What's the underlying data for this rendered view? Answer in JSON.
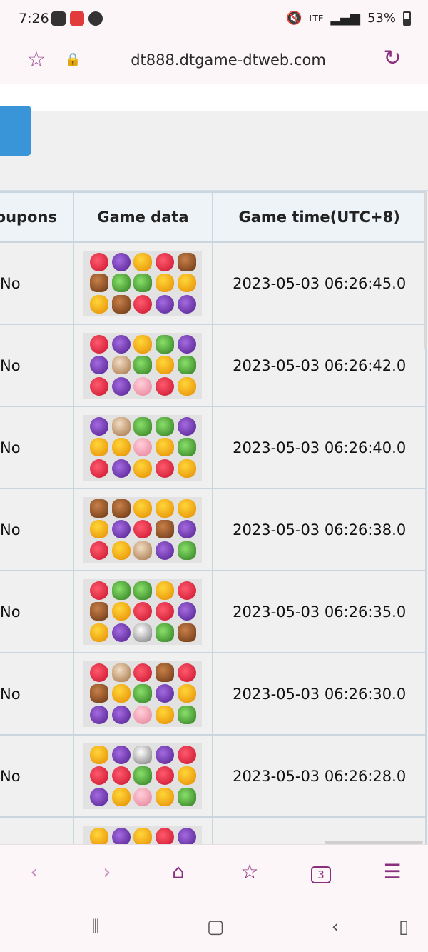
{
  "status_bar": {
    "time": "7:26",
    "battery_pct": "53%",
    "network": "LTE"
  },
  "browser": {
    "url": "dt888.dtgame-dtweb.com",
    "tab_count": "3"
  },
  "table": {
    "headers": [
      "oupons",
      "Game data",
      "Game time(UTC+8)"
    ],
    "rows": [
      {
        "coupon": "No",
        "time": "2023-05-03 06:26:45.0",
        "symbols": [
          "dragonfruit",
          "grape",
          "duck",
          "dragonfruit",
          "cow",
          "cow",
          "cucumber",
          "cucumber",
          "duck",
          "duck",
          "duck",
          "cow",
          "dragonfruit",
          "grape",
          "grape"
        ]
      },
      {
        "coupon": "No",
        "time": "2023-05-03 06:26:42.0",
        "symbols": [
          "dragonfruit",
          "grape",
          "duck",
          "cucumber",
          "grape",
          "grape",
          "dog",
          "cucumber",
          "duck",
          "cucumber",
          "dragonfruit",
          "grape",
          "pig",
          "dragonfruit",
          "duck"
        ]
      },
      {
        "coupon": "No",
        "time": "2023-05-03 06:26:40.0",
        "symbols": [
          "grape",
          "dog",
          "cucumber",
          "cucumber",
          "grape",
          "duck",
          "duck",
          "pig",
          "duck",
          "cucumber",
          "dragonfruit",
          "grape",
          "duck",
          "dragonfruit",
          "duck"
        ]
      },
      {
        "coupon": "No",
        "time": "2023-05-03 06:26:38.0",
        "symbols": [
          "cow",
          "cow",
          "duck",
          "duck",
          "duck",
          "duck",
          "grape",
          "dragonfruit",
          "cow",
          "grape",
          "dragonfruit",
          "duck",
          "dog",
          "grape",
          "cucumber"
        ]
      },
      {
        "coupon": "No",
        "time": "2023-05-03 06:26:35.0",
        "symbols": [
          "dragonfruit",
          "cucumber",
          "cucumber",
          "duck",
          "dragonfruit",
          "cow",
          "duck",
          "dragonfruit",
          "dragonfruit",
          "grape",
          "duck",
          "grape",
          "dairycow",
          "cucumber",
          "cow"
        ]
      },
      {
        "coupon": "No",
        "time": "2023-05-03 06:26:30.0",
        "symbols": [
          "dragonfruit",
          "dog",
          "dragonfruit",
          "cow",
          "dragonfruit",
          "cow",
          "duck",
          "cucumber",
          "grape",
          "duck",
          "grape",
          "grape",
          "pig",
          "duck",
          "cucumber"
        ]
      },
      {
        "coupon": "No",
        "time": "2023-05-03 06:26:28.0",
        "symbols": [
          "duck",
          "grape",
          "dairycow",
          "grape",
          "dragonfruit",
          "dragonfruit",
          "dragonfruit",
          "cucumber",
          "dragonfruit",
          "duck",
          "grape",
          "duck",
          "pig",
          "duck",
          "cucumber"
        ]
      },
      {
        "coupon": "",
        "time": "",
        "symbols": [
          "duck",
          "grape",
          "duck",
          "dragonfruit",
          "grape",
          "",
          "",
          "",
          "",
          "",
          "",
          "",
          "",
          "",
          ""
        ]
      }
    ]
  }
}
